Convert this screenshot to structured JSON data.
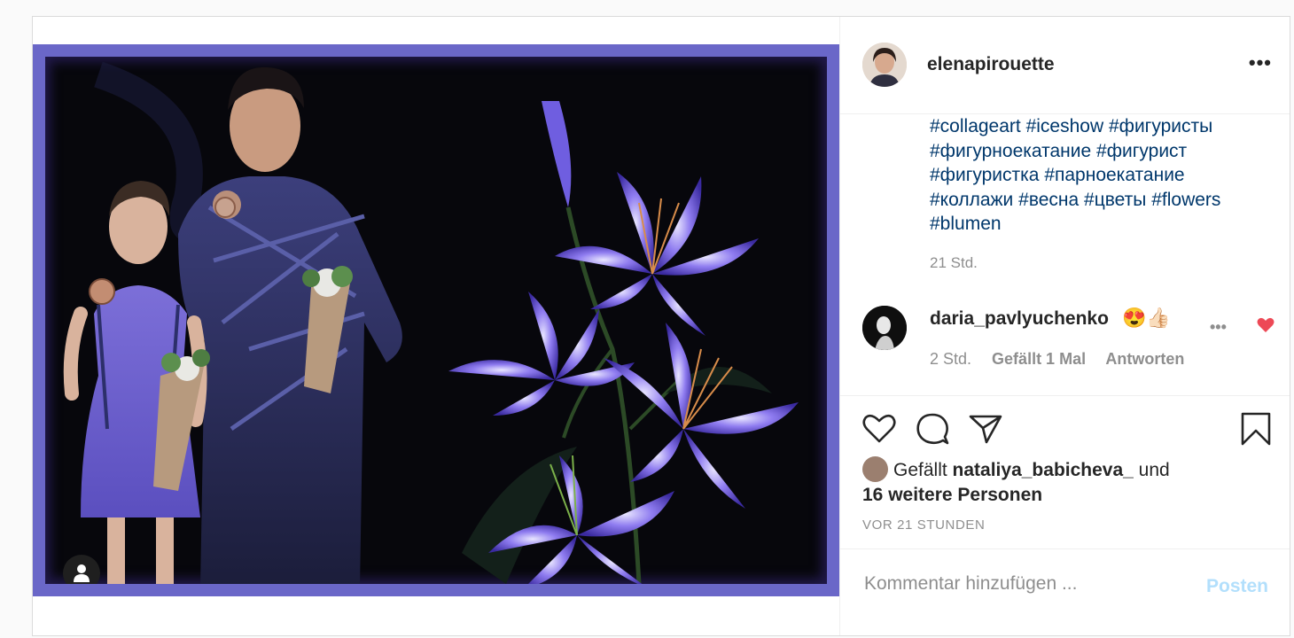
{
  "post": {
    "owner": {
      "username": "elenapirouette"
    },
    "more_label": "•••",
    "caption": {
      "hashtags": [
        "#collageart",
        "#iceshow",
        "#фигуристы",
        "#фигурноекатание",
        "#фигурист",
        "#фигуристка",
        "#парноекатание",
        "#коллажи",
        "#весна",
        "#цветы",
        "#flowers",
        "#blumen"
      ],
      "time": "21 Std."
    },
    "comment": {
      "username": "daria_pavlyuchenko",
      "emoji": "😍👍🏻",
      "time": "2 Std.",
      "likes_label": "Gefällt 1 Mal",
      "reply_label": "Antworten",
      "more_label": "•••"
    },
    "likes": {
      "prefix": "Gefällt",
      "user": "nataliya_babicheva_",
      "conjunction": "und",
      "others": "16 weitere Personen"
    },
    "timestamp": "VOR 21 STUNDEN",
    "add_comment": {
      "placeholder": "Kommentar hinzufügen ...",
      "post_label": "Posten"
    }
  },
  "colors": {
    "hashtag": "#00376b",
    "muted": "#8e8e8e",
    "heart": "#ed4956",
    "post_button_disabled": "#b2dffc",
    "frame": "#6a67c8"
  },
  "icons": [
    "user-tag-icon",
    "heart-icon",
    "comment-icon",
    "share-icon",
    "bookmark-icon",
    "more-icon"
  ]
}
